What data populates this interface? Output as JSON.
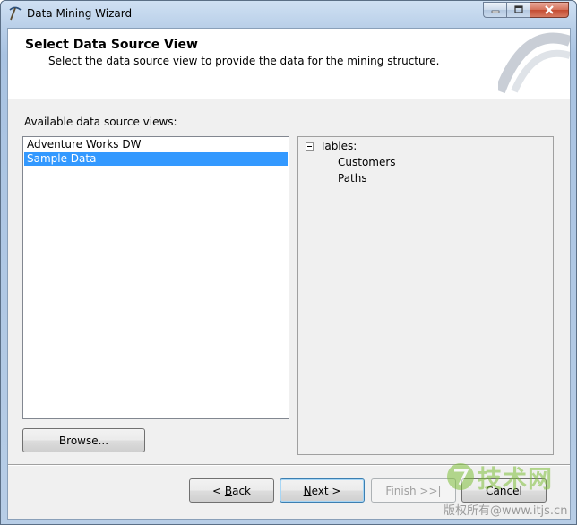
{
  "window": {
    "title": "Data Mining Wizard"
  },
  "header": {
    "title": "Select Data Source View",
    "subtitle": "Select the data source view to provide the data for the mining structure."
  },
  "main": {
    "available_label": "Available data source views:",
    "data_source_views": [
      {
        "label": "Adventure Works DW",
        "selected": false
      },
      {
        "label": "Sample Data",
        "selected": true
      }
    ],
    "browse_label": "Browse..."
  },
  "tree": {
    "root_label": "Tables:",
    "children": [
      "Customers",
      "Paths"
    ]
  },
  "footer": {
    "back_label": "< Back",
    "next_label": "Next >",
    "finish_label": "Finish >>|",
    "cancel_label": "Cancel"
  },
  "watermark": {
    "brand": "技术网",
    "url": "版权所有@www.itjs.cn"
  },
  "colors": {
    "selection": "#3399ff",
    "default_button_border": "#3c7fb1",
    "watermark_green": "#7fbf3a"
  }
}
